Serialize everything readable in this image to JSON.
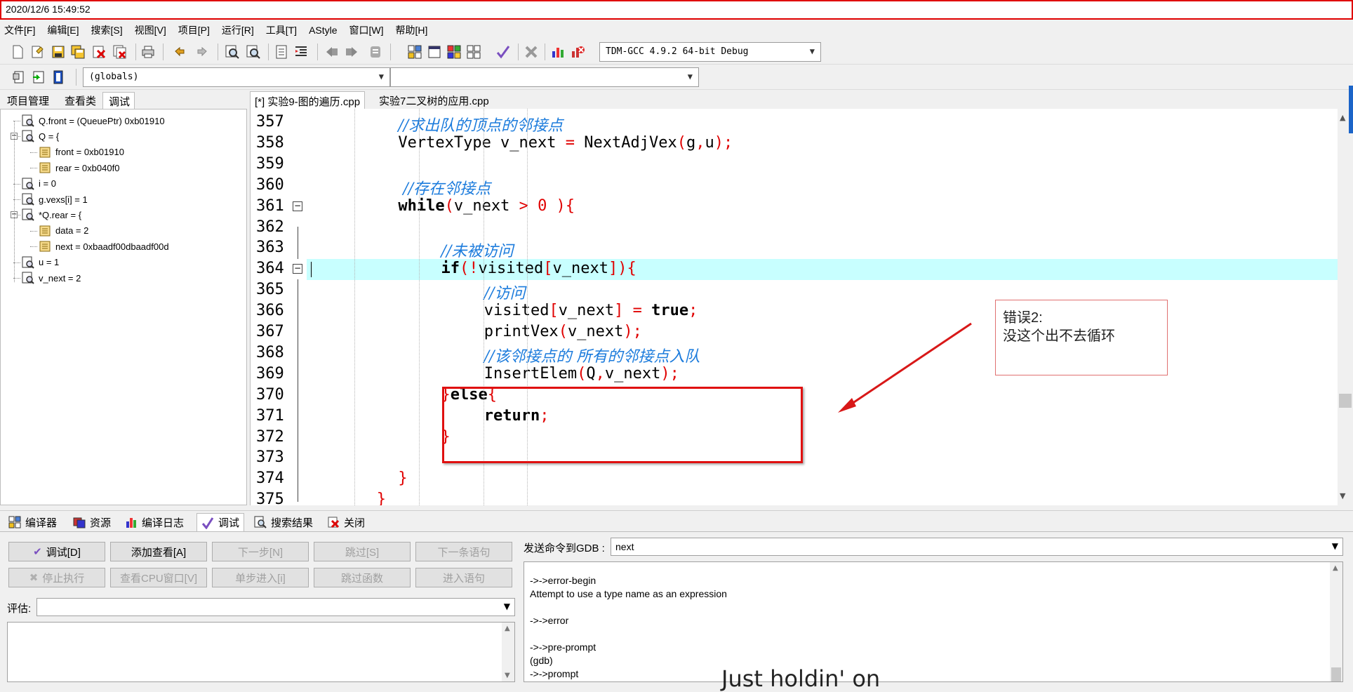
{
  "window": {
    "title": "2020/12/6 15:49:52"
  },
  "menu": [
    "文件[F]",
    "编辑[E]",
    "搜索[S]",
    "视图[V]",
    "项目[P]",
    "运行[R]",
    "工具[T]",
    "AStyle",
    "窗口[W]",
    "帮助[H]"
  ],
  "toolbar": {
    "compiler_select": "TDM-GCC 4.9.2 64-bit Debug",
    "scope_select": "(globals)",
    "icons": [
      "new-file-icon",
      "open-icon",
      "save-icon",
      "save-all-icon",
      "close-icon",
      "close-all-icon",
      "print-icon",
      "undo-icon",
      "redo-icon",
      "find-icon",
      "replace-icon",
      "goto-icon",
      "indent-icon",
      "unindent-icon",
      "bookmark-prev-icon",
      "bookmark-next-icon",
      "toggle-comment-icon",
      "compile-icon",
      "run-icon",
      "compile-run-icon",
      "rebuild-icon",
      "syntax-check-icon",
      "stop-icon",
      "profile-icon",
      "debug-icon"
    ]
  },
  "left_panel": {
    "tabs": [
      "项目管理",
      "查看类",
      "调试"
    ],
    "active_tab": "调试",
    "watch_items": [
      {
        "text": "Q.front = (QueuePtr) 0xb01910",
        "level": 0,
        "expander": ""
      },
      {
        "text": "Q = {",
        "level": 0,
        "expander": "−"
      },
      {
        "text": "front = 0xb01910",
        "level": 1,
        "expander": ""
      },
      {
        "text": "rear = 0xb040f0",
        "level": 1,
        "expander": ""
      },
      {
        "text": "i = 0",
        "level": 0,
        "expander": ""
      },
      {
        "text": "g.vexs[i] = 1",
        "level": 0,
        "expander": ""
      },
      {
        "text": "*Q.rear = {",
        "level": 0,
        "expander": "−"
      },
      {
        "text": "data = 2",
        "level": 1,
        "expander": ""
      },
      {
        "text": "next = 0xbaadf00dbaadf00d",
        "level": 1,
        "expander": ""
      },
      {
        "text": "u = 1",
        "level": 0,
        "expander": ""
      },
      {
        "text": "v_next = 2",
        "level": 0,
        "expander": ""
      }
    ]
  },
  "editor": {
    "tabs": [
      "[*] 实验9-图的遍历.cpp",
      "实验7二叉树的应用.cpp"
    ],
    "active_tab": "[*] 实验9-图的遍历.cpp",
    "highlighted_line": 364,
    "lines": [
      {
        "n": "357",
        "fold": "",
        "indent": 8,
        "tokens": [
          {
            "t": "//求出队的顶点的邻接点",
            "c": "cm"
          }
        ]
      },
      {
        "n": "358",
        "fold": "",
        "indent": 8,
        "tokens": [
          {
            "t": "VertexType v_next ",
            "c": ""
          },
          {
            "t": "=",
            "c": "sym"
          },
          {
            "t": " NextAdjVex",
            "c": ""
          },
          {
            "t": "(",
            "c": "sym"
          },
          {
            "t": "g",
            "c": ""
          },
          {
            "t": ",",
            "c": "sym"
          },
          {
            "t": "u",
            "c": ""
          },
          {
            "t": ");",
            "c": "sym"
          }
        ]
      },
      {
        "n": "359",
        "fold": "",
        "indent": 8,
        "tokens": []
      },
      {
        "n": "360",
        "fold": "",
        "indent": 8,
        "tokens": [
          {
            "t": " //存在邻接点",
            "c": "cm"
          }
        ]
      },
      {
        "n": "361",
        "fold": "−",
        "indent": 8,
        "tokens": [
          {
            "t": "while",
            "c": "kw"
          },
          {
            "t": "(",
            "c": "sym"
          },
          {
            "t": "v_next ",
            "c": ""
          },
          {
            "t": ">",
            "c": "sym"
          },
          {
            "t": " ",
            "c": ""
          },
          {
            "t": "0",
            "c": "num"
          },
          {
            "t": " ){",
            "c": "sym"
          }
        ]
      },
      {
        "n": "362",
        "fold": "",
        "indent": 8,
        "tokens": []
      },
      {
        "n": "363",
        "fold": "",
        "indent": 12,
        "tokens": [
          {
            "t": "//未被访问",
            "c": "cm"
          }
        ]
      },
      {
        "n": "364",
        "fold": "−",
        "indent": 12,
        "tokens": [
          {
            "t": "if",
            "c": "kw"
          },
          {
            "t": "(!",
            "c": "sym"
          },
          {
            "t": "visited",
            "c": ""
          },
          {
            "t": "[",
            "c": "sym"
          },
          {
            "t": "v_next",
            "c": ""
          },
          {
            "t": "]){",
            "c": "sym"
          }
        ]
      },
      {
        "n": "365",
        "fold": "",
        "indent": 16,
        "tokens": [
          {
            "t": "//访问",
            "c": "cm"
          }
        ]
      },
      {
        "n": "366",
        "fold": "",
        "indent": 16,
        "tokens": [
          {
            "t": "visited",
            "c": ""
          },
          {
            "t": "[",
            "c": "sym"
          },
          {
            "t": "v_next",
            "c": ""
          },
          {
            "t": "]",
            "c": "sym"
          },
          {
            "t": " ",
            "c": ""
          },
          {
            "t": "=",
            "c": "sym"
          },
          {
            "t": " ",
            "c": ""
          },
          {
            "t": "true",
            "c": "kw"
          },
          {
            "t": ";",
            "c": "sym"
          }
        ]
      },
      {
        "n": "367",
        "fold": "",
        "indent": 16,
        "tokens": [
          {
            "t": "printVex",
            "c": ""
          },
          {
            "t": "(",
            "c": "sym"
          },
          {
            "t": "v_next",
            "c": ""
          },
          {
            "t": ");",
            "c": "sym"
          }
        ]
      },
      {
        "n": "368",
        "fold": "",
        "indent": 16,
        "tokens": [
          {
            "t": "//该邻接点的 所有的邻接点入队",
            "c": "cm"
          }
        ]
      },
      {
        "n": "369",
        "fold": "",
        "indent": 16,
        "tokens": [
          {
            "t": "InsertElem",
            "c": ""
          },
          {
            "t": "(",
            "c": "sym"
          },
          {
            "t": "Q",
            "c": ""
          },
          {
            "t": ",",
            "c": "sym"
          },
          {
            "t": "v_next",
            "c": ""
          },
          {
            "t": ");",
            "c": "sym"
          }
        ]
      },
      {
        "n": "370",
        "fold": "",
        "indent": 12,
        "tokens": [
          {
            "t": "}",
            "c": "sym"
          },
          {
            "t": "else",
            "c": "kw"
          },
          {
            "t": "{",
            "c": "sym"
          }
        ]
      },
      {
        "n": "371",
        "fold": "",
        "indent": 16,
        "tokens": [
          {
            "t": "return",
            "c": "kw"
          },
          {
            "t": ";",
            "c": "sym"
          }
        ]
      },
      {
        "n": "372",
        "fold": "",
        "indent": 12,
        "tokens": [
          {
            "t": "}",
            "c": "sym"
          }
        ]
      },
      {
        "n": "373",
        "fold": "",
        "indent": 8,
        "tokens": []
      },
      {
        "n": "374",
        "fold": "",
        "indent": 8,
        "tokens": [
          {
            "t": "}",
            "c": "sym"
          }
        ]
      },
      {
        "n": "375",
        "fold": "",
        "indent": 6,
        "tokens": [
          {
            "t": "}",
            "c": "sym"
          }
        ]
      }
    ]
  },
  "annotation": {
    "line1": "错误2:",
    "line2": "没这个出不去循环"
  },
  "bottom_tabs": [
    {
      "label": "编译器",
      "icon": "compiler-grid-icon"
    },
    {
      "label": "资源",
      "icon": "resources-icon"
    },
    {
      "label": "编译日志",
      "icon": "compile-log-chart-icon"
    },
    {
      "label": "调试",
      "icon": "debug-check-icon"
    },
    {
      "label": "搜索结果",
      "icon": "search-results-icon"
    },
    {
      "label": "关闭",
      "icon": "close-panel-icon"
    }
  ],
  "bottom_active_tab": "调试",
  "debug_panel": {
    "buttons_row1": [
      {
        "label": "调试[D]",
        "enabled": true,
        "icon": "check-icon"
      },
      {
        "label": "添加查看[A]",
        "enabled": true,
        "icon": ""
      },
      {
        "label": "下一步[N]",
        "enabled": false,
        "icon": ""
      },
      {
        "label": "跳过[S]",
        "enabled": false,
        "icon": ""
      },
      {
        "label": "下一条语句",
        "enabled": false,
        "icon": ""
      }
    ],
    "buttons_row2": [
      {
        "label": "停止执行",
        "enabled": false,
        "icon": "stop-x-icon"
      },
      {
        "label": "查看CPU窗口[V]",
        "enabled": false,
        "icon": ""
      },
      {
        "label": "单步进入[i]",
        "enabled": false,
        "icon": ""
      },
      {
        "label": "跳过函数",
        "enabled": false,
        "icon": ""
      },
      {
        "label": "进入语句",
        "enabled": false,
        "icon": ""
      }
    ],
    "evaluate_label": "评估:",
    "evaluate_value": "",
    "send_label": "发送命令到GDB :",
    "send_value": "next",
    "output_lines": [
      "->->error-begin",
      "Attempt to use a type name as an expression",
      "",
      "->->error",
      "",
      "->->pre-prompt",
      "(gdb)",
      "->->prompt"
    ]
  },
  "watermark": "Just holdin' on"
}
